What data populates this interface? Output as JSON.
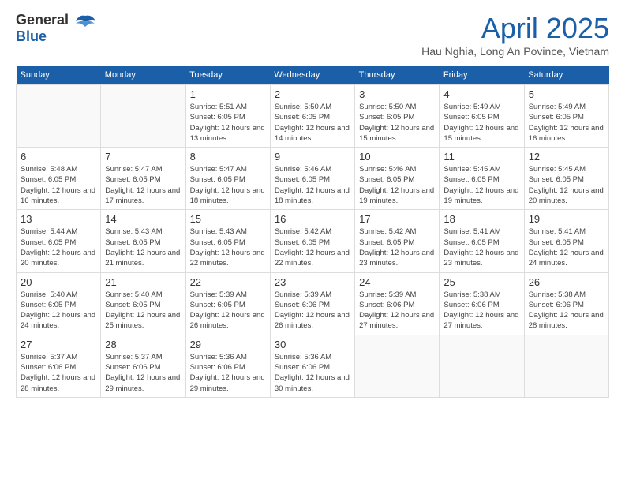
{
  "header": {
    "logo": {
      "general": "General",
      "blue": "Blue"
    },
    "title": "April 2025",
    "location": "Hau Nghia, Long An Povince, Vietnam"
  },
  "weekdays": [
    "Sunday",
    "Monday",
    "Tuesday",
    "Wednesday",
    "Thursday",
    "Friday",
    "Saturday"
  ],
  "weeks": [
    [
      {
        "day": "",
        "sunrise": "",
        "sunset": "",
        "daylight": ""
      },
      {
        "day": "",
        "sunrise": "",
        "sunset": "",
        "daylight": ""
      },
      {
        "day": "1",
        "sunrise": "Sunrise: 5:51 AM",
        "sunset": "Sunset: 6:05 PM",
        "daylight": "Daylight: 12 hours and 13 minutes."
      },
      {
        "day": "2",
        "sunrise": "Sunrise: 5:50 AM",
        "sunset": "Sunset: 6:05 PM",
        "daylight": "Daylight: 12 hours and 14 minutes."
      },
      {
        "day": "3",
        "sunrise": "Sunrise: 5:50 AM",
        "sunset": "Sunset: 6:05 PM",
        "daylight": "Daylight: 12 hours and 15 minutes."
      },
      {
        "day": "4",
        "sunrise": "Sunrise: 5:49 AM",
        "sunset": "Sunset: 6:05 PM",
        "daylight": "Daylight: 12 hours and 15 minutes."
      },
      {
        "day": "5",
        "sunrise": "Sunrise: 5:49 AM",
        "sunset": "Sunset: 6:05 PM",
        "daylight": "Daylight: 12 hours and 16 minutes."
      }
    ],
    [
      {
        "day": "6",
        "sunrise": "Sunrise: 5:48 AM",
        "sunset": "Sunset: 6:05 PM",
        "daylight": "Daylight: 12 hours and 16 minutes."
      },
      {
        "day": "7",
        "sunrise": "Sunrise: 5:47 AM",
        "sunset": "Sunset: 6:05 PM",
        "daylight": "Daylight: 12 hours and 17 minutes."
      },
      {
        "day": "8",
        "sunrise": "Sunrise: 5:47 AM",
        "sunset": "Sunset: 6:05 PM",
        "daylight": "Daylight: 12 hours and 18 minutes."
      },
      {
        "day": "9",
        "sunrise": "Sunrise: 5:46 AM",
        "sunset": "Sunset: 6:05 PM",
        "daylight": "Daylight: 12 hours and 18 minutes."
      },
      {
        "day": "10",
        "sunrise": "Sunrise: 5:46 AM",
        "sunset": "Sunset: 6:05 PM",
        "daylight": "Daylight: 12 hours and 19 minutes."
      },
      {
        "day": "11",
        "sunrise": "Sunrise: 5:45 AM",
        "sunset": "Sunset: 6:05 PM",
        "daylight": "Daylight: 12 hours and 19 minutes."
      },
      {
        "day": "12",
        "sunrise": "Sunrise: 5:45 AM",
        "sunset": "Sunset: 6:05 PM",
        "daylight": "Daylight: 12 hours and 20 minutes."
      }
    ],
    [
      {
        "day": "13",
        "sunrise": "Sunrise: 5:44 AM",
        "sunset": "Sunset: 6:05 PM",
        "daylight": "Daylight: 12 hours and 20 minutes."
      },
      {
        "day": "14",
        "sunrise": "Sunrise: 5:43 AM",
        "sunset": "Sunset: 6:05 PM",
        "daylight": "Daylight: 12 hours and 21 minutes."
      },
      {
        "day": "15",
        "sunrise": "Sunrise: 5:43 AM",
        "sunset": "Sunset: 6:05 PM",
        "daylight": "Daylight: 12 hours and 22 minutes."
      },
      {
        "day": "16",
        "sunrise": "Sunrise: 5:42 AM",
        "sunset": "Sunset: 6:05 PM",
        "daylight": "Daylight: 12 hours and 22 minutes."
      },
      {
        "day": "17",
        "sunrise": "Sunrise: 5:42 AM",
        "sunset": "Sunset: 6:05 PM",
        "daylight": "Daylight: 12 hours and 23 minutes."
      },
      {
        "day": "18",
        "sunrise": "Sunrise: 5:41 AM",
        "sunset": "Sunset: 6:05 PM",
        "daylight": "Daylight: 12 hours and 23 minutes."
      },
      {
        "day": "19",
        "sunrise": "Sunrise: 5:41 AM",
        "sunset": "Sunset: 6:05 PM",
        "daylight": "Daylight: 12 hours and 24 minutes."
      }
    ],
    [
      {
        "day": "20",
        "sunrise": "Sunrise: 5:40 AM",
        "sunset": "Sunset: 6:05 PM",
        "daylight": "Daylight: 12 hours and 24 minutes."
      },
      {
        "day": "21",
        "sunrise": "Sunrise: 5:40 AM",
        "sunset": "Sunset: 6:05 PM",
        "daylight": "Daylight: 12 hours and 25 minutes."
      },
      {
        "day": "22",
        "sunrise": "Sunrise: 5:39 AM",
        "sunset": "Sunset: 6:05 PM",
        "daylight": "Daylight: 12 hours and 26 minutes."
      },
      {
        "day": "23",
        "sunrise": "Sunrise: 5:39 AM",
        "sunset": "Sunset: 6:06 PM",
        "daylight": "Daylight: 12 hours and 26 minutes."
      },
      {
        "day": "24",
        "sunrise": "Sunrise: 5:39 AM",
        "sunset": "Sunset: 6:06 PM",
        "daylight": "Daylight: 12 hours and 27 minutes."
      },
      {
        "day": "25",
        "sunrise": "Sunrise: 5:38 AM",
        "sunset": "Sunset: 6:06 PM",
        "daylight": "Daylight: 12 hours and 27 minutes."
      },
      {
        "day": "26",
        "sunrise": "Sunrise: 5:38 AM",
        "sunset": "Sunset: 6:06 PM",
        "daylight": "Daylight: 12 hours and 28 minutes."
      }
    ],
    [
      {
        "day": "27",
        "sunrise": "Sunrise: 5:37 AM",
        "sunset": "Sunset: 6:06 PM",
        "daylight": "Daylight: 12 hours and 28 minutes."
      },
      {
        "day": "28",
        "sunrise": "Sunrise: 5:37 AM",
        "sunset": "Sunset: 6:06 PM",
        "daylight": "Daylight: 12 hours and 29 minutes."
      },
      {
        "day": "29",
        "sunrise": "Sunrise: 5:36 AM",
        "sunset": "Sunset: 6:06 PM",
        "daylight": "Daylight: 12 hours and 29 minutes."
      },
      {
        "day": "30",
        "sunrise": "Sunrise: 5:36 AM",
        "sunset": "Sunset: 6:06 PM",
        "daylight": "Daylight: 12 hours and 30 minutes."
      },
      {
        "day": "",
        "sunrise": "",
        "sunset": "",
        "daylight": ""
      },
      {
        "day": "",
        "sunrise": "",
        "sunset": "",
        "daylight": ""
      },
      {
        "day": "",
        "sunrise": "",
        "sunset": "",
        "daylight": ""
      }
    ]
  ]
}
